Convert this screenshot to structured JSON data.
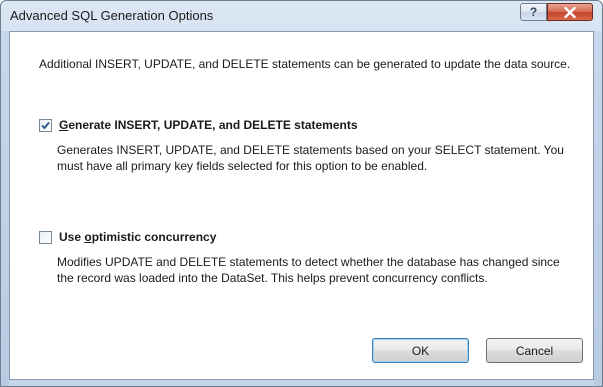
{
  "window": {
    "title": "Advanced SQL Generation Options",
    "help_button": "?"
  },
  "content": {
    "intro": "Additional INSERT, UPDATE, and DELETE statements can be generated to update the data source.",
    "option1": {
      "mnemonic": "G",
      "label_rest": "enerate INSERT, UPDATE, and DELETE statements",
      "checked": true,
      "description": "Generates INSERT, UPDATE, and DELETE statements based on your SELECT statement. You must have all primary key fields selected for this option to be enabled."
    },
    "option2": {
      "label_prefix": "Use ",
      "mnemonic": "o",
      "label_rest": "ptimistic concurrency",
      "checked": false,
      "description": "Modifies UPDATE and DELETE statements to detect whether the database has changed since the record was loaded into the DataSet. This helps prevent concurrency conflicts."
    }
  },
  "buttons": {
    "ok": "OK",
    "cancel": "Cancel"
  },
  "colors": {
    "close_button": "#c4442a",
    "default_button_border": "#3c7fb1"
  }
}
